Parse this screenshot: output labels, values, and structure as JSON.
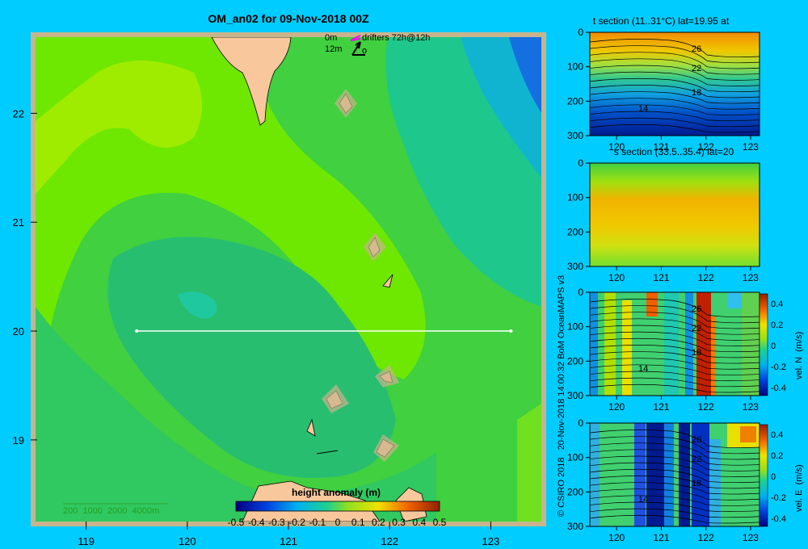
{
  "title": "OM_an02 for 09-Nov-2018 00Z",
  "legend": {
    "row1_depth": "0m",
    "row1_label": "drifters 72h@12h",
    "row2_depth": "12m",
    "row2_label": "o"
  },
  "bathymetry_legend": "200  1000  2000  4000m",
  "credit": "© CSIRO 2018   20-Nov-2018 14:00:32 BoM OceanMAPS v3",
  "colors": {
    "background": "#00ccff",
    "frame": "#c8b48c",
    "land": "#f8c89c",
    "transect_line": "#ffffff"
  },
  "chart_data": [
    {
      "type": "heatmap",
      "id": "map",
      "title": "OM_an02 for 09-Nov-2018 00Z",
      "x_ticks": [
        "119",
        "120",
        "121",
        "122",
        "123"
      ],
      "y_ticks": [
        "22",
        "21",
        "20",
        "19"
      ],
      "x_range": [
        118.5,
        123.5
      ],
      "y_range": [
        18.25,
        22.7
      ],
      "transect": {
        "lat": 20,
        "lon_start": 119.5,
        "lon_end": 123.2
      },
      "colorbar": {
        "title": "height anomaly  (m)",
        "ticks": [
          "-0.5",
          "-0.4",
          "-0.3",
          "-0.2",
          "-0.1",
          "0",
          "0.1",
          "0.2",
          "0.3",
          "0.4",
          "0.5"
        ]
      }
    },
    {
      "type": "heatmap",
      "id": "t-section",
      "title": "t section (11..31°C) lat=19.95 at",
      "x_ticks": [
        "120",
        "121",
        "122",
        "123"
      ],
      "y_ticks": [
        "0",
        "100",
        "200",
        "300"
      ],
      "contour_labels": [
        "26",
        "22",
        "18",
        "14"
      ]
    },
    {
      "type": "heatmap",
      "id": "s-section",
      "title": "s section (33.5..35.4) lat=20",
      "x_ticks": [
        "120",
        "121",
        "122",
        "123"
      ],
      "y_ticks": [
        "0",
        "100",
        "200",
        "300"
      ]
    },
    {
      "type": "heatmap",
      "id": "vel-n-section",
      "x_ticks": [
        "120",
        "121",
        "122",
        "123"
      ],
      "y_ticks": [
        "0",
        "100",
        "200",
        "300"
      ],
      "contour_labels": [
        "26",
        "22",
        "18",
        "14"
      ],
      "colorbar": {
        "label": "vel. N  (m/s)",
        "ticks": [
          "0.4",
          "0.2",
          "0",
          "-0.2",
          "-0.4"
        ]
      }
    },
    {
      "type": "heatmap",
      "id": "vel-e-section",
      "x_ticks": [
        "120",
        "121",
        "122",
        "123"
      ],
      "y_ticks": [
        "0",
        "100",
        "200",
        "300"
      ],
      "contour_labels": [
        "26",
        "22",
        "18",
        "14"
      ],
      "colorbar": {
        "label": "vel. E  (m/s)",
        "ticks": [
          "0.4",
          "0.2",
          "0",
          "-0.2",
          "-0.4"
        ]
      }
    }
  ]
}
